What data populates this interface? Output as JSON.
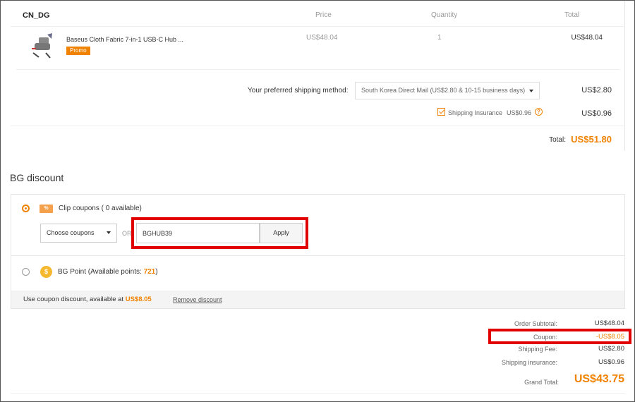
{
  "order": {
    "store": "CN_DG",
    "headers": {
      "price": "Price",
      "quantity": "Quantity",
      "total": "Total"
    },
    "item": {
      "name": "Baseus Cloth Fabric 7-in-1 USB-C Hub ...",
      "badge": "Promo",
      "price": "US$48.04",
      "quantity": "1",
      "total": "US$48.04"
    },
    "shipping": {
      "label": "Your preferred shipping method:",
      "selected": "South Korea Direct Mail (US$2.80 & 10-15 business days)",
      "fee": "US$2.80"
    },
    "insurance": {
      "checked": true,
      "label": "Shipping Insurance",
      "amount": "US$0.96",
      "fee": "US$0.96"
    },
    "total_label": "Total:",
    "total": "US$51.80"
  },
  "discount": {
    "title": "BG discount",
    "clip": {
      "icon_text": "%",
      "label": "Clip coupons ( 0 available)",
      "select_placeholder": "Choose coupons",
      "or_text": "OR",
      "code_value": "BGHUB39",
      "apply_label": "Apply"
    },
    "points": {
      "icon_text": "$",
      "label": "BG Point (Available points: ",
      "value": "721",
      "suffix": ")"
    },
    "bar": {
      "text": "Use coupon discount, available at ",
      "amount": "US$8.05",
      "remove_label": "Remove discount"
    }
  },
  "summary": {
    "subtotal_label": "Order Subtotal:",
    "subtotal": "US$48.04",
    "coupon_label": "Coupon:",
    "coupon": "-US$8.05",
    "shipping_label": "Shipping Fee:",
    "shipping": "US$2.80",
    "insurance_label": "Shipping insurance:",
    "insurance": "US$0.96",
    "grand_label": "Grand Total:",
    "grand": "US$43.75"
  },
  "colors": {
    "accent": "#f08200",
    "highlight": "#e00000"
  }
}
